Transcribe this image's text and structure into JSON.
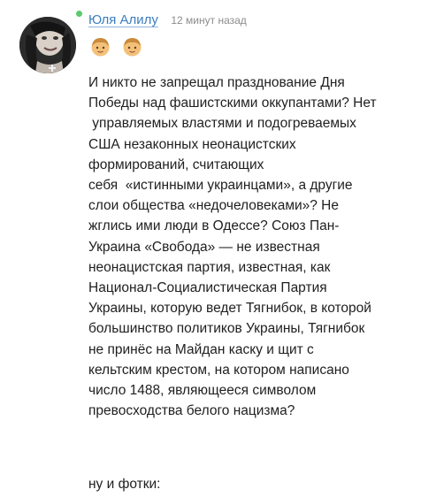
{
  "comment": {
    "author": "Юля Алилу",
    "time": "12 минут назад",
    "badges": [
      {
        "icon": "boy-emoji-icon"
      },
      {
        "icon": "boy-emoji-icon"
      }
    ],
    "lines": [
      "И никто не запрещал празднование Дня",
      "Победы над фашистскими оккупантами? Нет",
      " управляемых властями и подогреваемых",
      "США незаконных неонацистских",
      "формирований, считающих",
      "себя  «истинными украинцами», а другие",
      "слои общества «недочеловеками»? Не",
      "жглись ими люди в Одессе? Союз Пан-",
      "Украина «Свобода» — не известная",
      "неонацистская партия, известная, как",
      "Национал-Социалистическая Партия",
      "Украины, которую ведет Тягнибок, в которой",
      "большинство политиков Украины, Тягнибок",
      "не принёс на Майдан каску и щит с",
      "кельтским крестом, на котором написано",
      "число 1488, являющееся символом",
      "превосходства белого нацизма?"
    ],
    "second_paragraph": "ну и фотки:"
  },
  "colors": {
    "author_link": "#3d7fbf",
    "online": "#5cc96d",
    "time": "#8c8c8c",
    "text": "#1f1f1f"
  }
}
